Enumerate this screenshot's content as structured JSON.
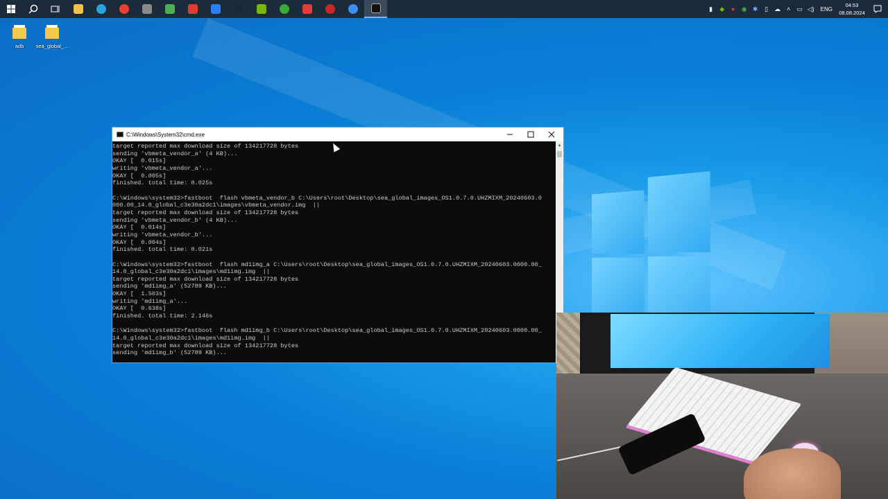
{
  "taskbar": {
    "apps": [
      {
        "name": "file-explorer",
        "color": "#f2c14a"
      },
      {
        "name": "telegram",
        "color": "#2aa3e0"
      },
      {
        "name": "chrome",
        "color": "#e5412f"
      },
      {
        "name": "app-shield",
        "color": "#8a8a8a"
      },
      {
        "name": "notepad-green",
        "color": "#4caf50"
      },
      {
        "name": "opera-red",
        "color": "#e53935"
      },
      {
        "name": "app-blue-L",
        "color": "#2d7ff9"
      },
      {
        "name": "steam",
        "color": "#1b2838"
      },
      {
        "name": "nvidia",
        "color": "#76b900"
      },
      {
        "name": "xbox",
        "color": "#3aa935"
      },
      {
        "name": "anydesk",
        "color": "#e23b3b"
      },
      {
        "name": "app-dark-red",
        "color": "#c62828"
      },
      {
        "name": "app-globe",
        "color": "#3d8ef0"
      },
      {
        "name": "cmd",
        "color": "#111111"
      }
    ],
    "tray": {
      "language": "ENG",
      "time": "04:53",
      "date": "08.08.2024"
    }
  },
  "desktop": {
    "icons": [
      {
        "label": "adb"
      },
      {
        "label": "sea_global_..."
      }
    ]
  },
  "cmd_window": {
    "title": "C:\\Windows\\System32\\cmd.exe",
    "lines": [
      "target reported max download size of 134217728 bytes",
      "sending 'vbmeta_vendor_a' (4 KB)...",
      "OKAY [  0.015s]",
      "writing 'vbmeta_vendor_a'...",
      "OKAY [  0.005s]",
      "finished. total time: 0.025s",
      "",
      "C:\\Windows\\system32>fastboot  flash vbmeta_vendor_b C:\\Users\\root\\Desktop\\sea_global_images_OS1.0.7.0.UHZMIXM_20240603.0",
      "000.00_14.0_global_c3e30a2dc1\\images\\vbmeta_vendor.img  ||",
      "target reported max download size of 134217728 bytes",
      "sending 'vbmeta_vendor_b' (4 KB)...",
      "OKAY [  0.014s]",
      "writing 'vbmeta_vendor_b'...",
      "OKAY [  0.004s]",
      "finished. total time: 0.021s",
      "",
      "C:\\Windows\\system32>fastboot  flash md1img_a C:\\Users\\root\\Desktop\\sea_global_images_OS1.0.7.0.UHZMIXM_20240603.0000.00_",
      "14.0_global_c3e30a2dc1\\images\\md1img.img  ||",
      "target reported max download size of 134217728 bytes",
      "sending 'md1img_a' (52789 KB)...",
      "OKAY [  1.503s]",
      "writing 'md1img_a'...",
      "OKAY [  0.638s]",
      "finished. total time: 2.146s",
      "",
      "C:\\Windows\\system32>fastboot  flash md1img_b C:\\Users\\root\\Desktop\\sea_global_images_OS1.0.7.0.UHZMIXM_20240603.0000.00_",
      "14.0_global_c3e30a2dc1\\images\\md1img.img  ||",
      "target reported max download size of 134217728 bytes",
      "sending 'md1img_b' (52789 KB)..."
    ]
  }
}
